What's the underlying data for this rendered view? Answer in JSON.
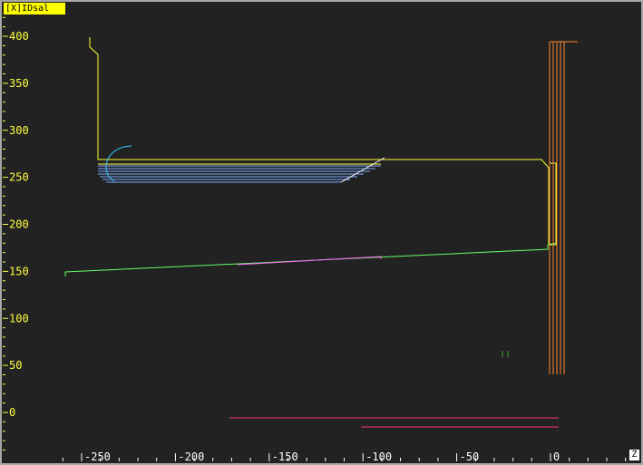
{
  "window": {
    "title_badge": "[X]IDsal",
    "axis_letter": "Z"
  },
  "y_axis_labels": [
    "400",
    "350",
    "300",
    "250",
    "200",
    "150",
    "100",
    "50",
    "0"
  ],
  "x_axis_labels": [
    "-250",
    "-200",
    "-150",
    "-100",
    "-50",
    "0"
  ],
  "colors": {
    "background": "#222222",
    "axis_text": "#ffff40",
    "workpiece_profile": "#ffff33",
    "roughing_passes": "#66aaff",
    "finishing_arc": "#33ccff",
    "taper_line": "#66ff66",
    "taper_highlight": "#ff66ff",
    "tool_lines": "#ff8833",
    "bottom_lines": "#ff3377",
    "small_marks": "#33aa33"
  }
}
